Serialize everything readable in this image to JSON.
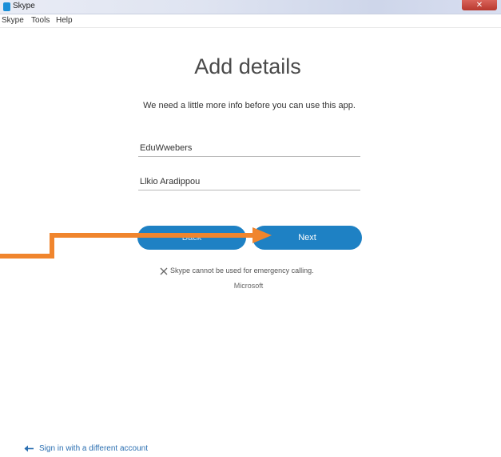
{
  "window": {
    "title": "Skype",
    "close_label": "✕"
  },
  "menu": [
    "Skype",
    "Tools",
    "Help"
  ],
  "page": {
    "heading": "Add details",
    "subtitle": "We need a little more info before you can use this app."
  },
  "form": {
    "first_name": "EduWwebers",
    "last_name": "Llkio Aradippou"
  },
  "buttons": {
    "back": "Back",
    "next": "Next"
  },
  "notice": "Skype cannot be used for emergency calling.",
  "footer": {
    "company": "Microsoft",
    "sign_in_other": "Sign in with a different account"
  },
  "colors": {
    "button": "#1e81c4",
    "annotation_arrow": "#f0852d",
    "link": "#2b6fb1"
  }
}
